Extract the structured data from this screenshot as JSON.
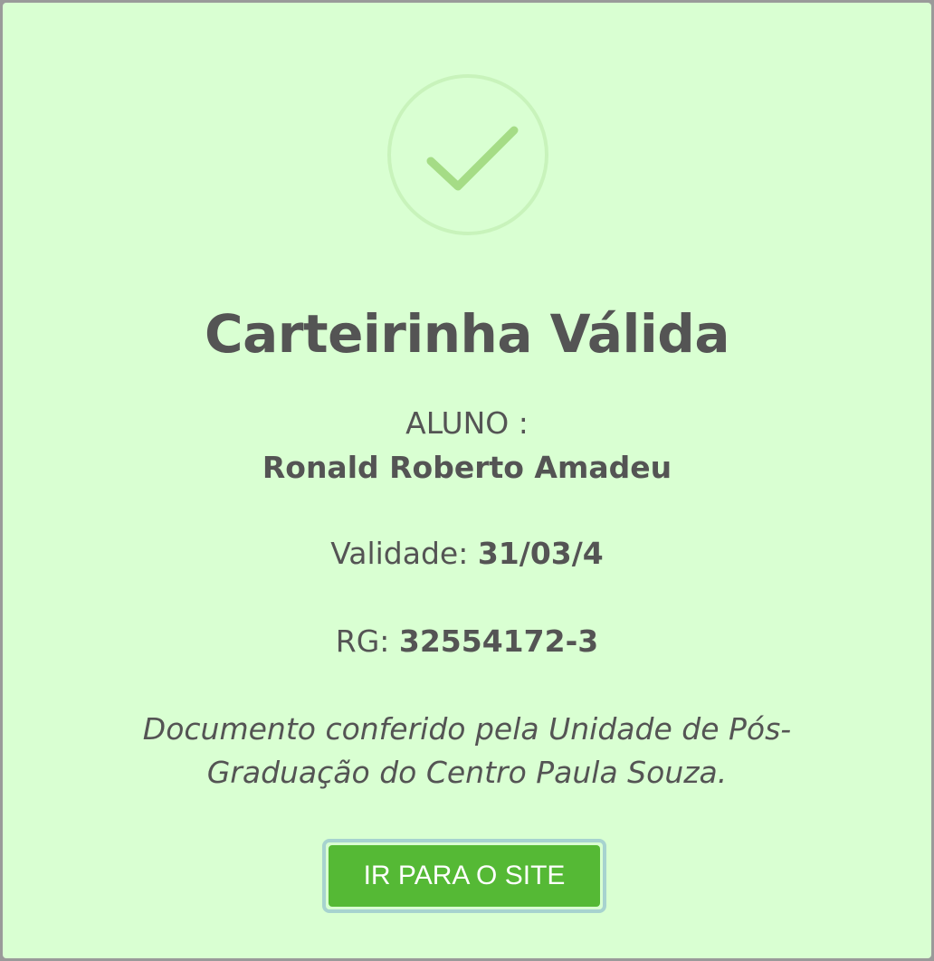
{
  "dialog": {
    "icon": "check-icon",
    "title": "Carteirinha Válida",
    "aluno_label": "ALUNO :",
    "aluno_name": "Ronald Roberto Amadeu",
    "validade_label": "Validade: ",
    "validade_value": "31/03/4",
    "rg_label": "RG: ",
    "rg_value": "32554172-3",
    "note": "Documento conferido pela Unidade de Pós-Graduação do Centro Paula Souza.",
    "button_label": "IR PARA O SITE"
  },
  "colors": {
    "background": "#d9ffd2",
    "overlay": "#9a9a9a",
    "text": "#545454",
    "check": "#a5dc86",
    "ring": "#c8f3bb",
    "button": "#55b935",
    "button_focus": "#a7d3cf"
  }
}
